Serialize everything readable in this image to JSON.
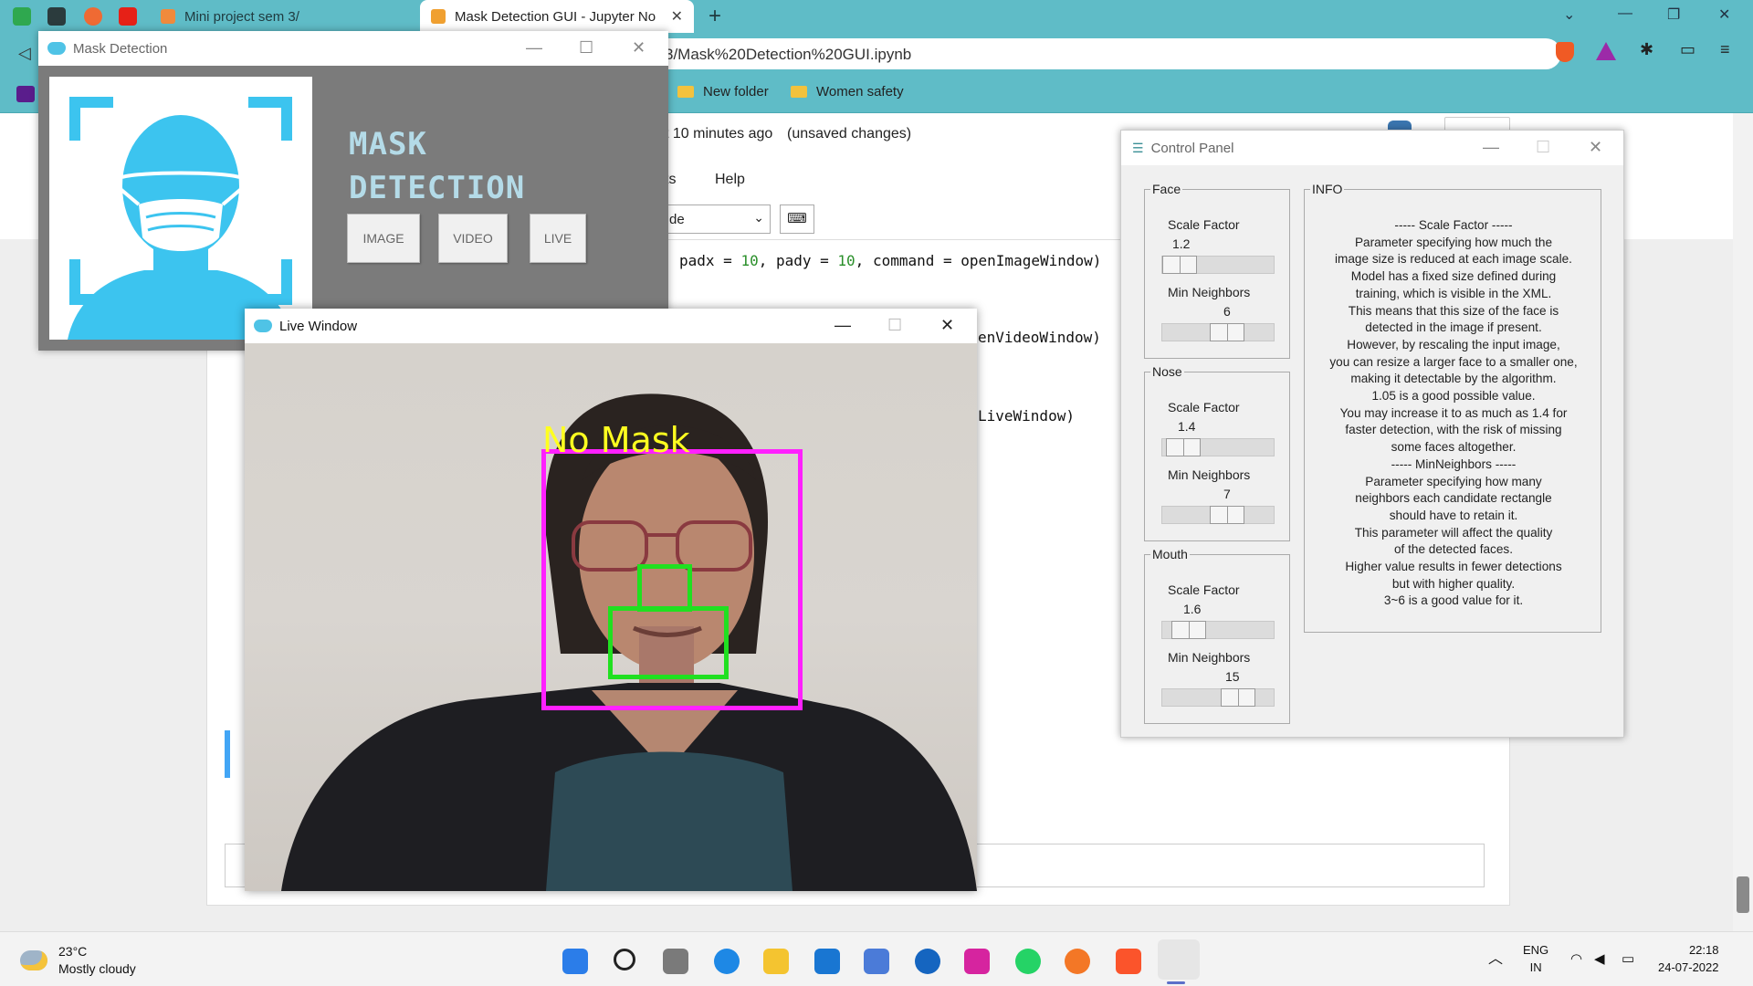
{
  "browser": {
    "tabs": [
      {
        "label": "Mini project sem 3/"
      },
      {
        "label": "Mask Detection GUI - Jupyter No"
      }
    ],
    "new_tab_symbol": "+",
    "address": "3/Mask%20Detection%20GUI.ipynb",
    "bookmarks": [
      {
        "label": "New folder"
      },
      {
        "label": "Women safety"
      }
    ]
  },
  "jupyter": {
    "save_status": "t 10 minutes ago",
    "unsaved": "(unsaved changes)",
    "menu_partial": "ts",
    "help": "Help",
    "celltype_partial": "de",
    "code_lines": [
      {
        "pre": "padx = ",
        "n1": "10",
        "mid": ", pady = ",
        "n2": "10",
        "post": ", command = openImageWindow)"
      },
      {
        "pre": "enVideoWindow)"
      },
      {
        "pre": "LiveWindow)"
      }
    ]
  },
  "main_window": {
    "title": "Mask Detection",
    "heading_line1": "MASK",
    "heading_line2": "DETECTION",
    "buttons": [
      "IMAGE",
      "VIDEO",
      "LIVE"
    ]
  },
  "live_window": {
    "title": "Live Window",
    "detection_label": "No Mask"
  },
  "control_panel": {
    "title": "Control Panel",
    "groups": [
      {
        "name": "Face",
        "scale_label": "Scale Factor",
        "scale_value": "1.2",
        "neighbors_label": "Min Neighbors",
        "neighbors_value": "6"
      },
      {
        "name": "Nose",
        "scale_label": "Scale Factor",
        "scale_value": "1.4",
        "neighbors_label": "Min Neighbors",
        "neighbors_value": "7"
      },
      {
        "name": "Mouth",
        "scale_label": "Scale Factor",
        "scale_value": "1.6",
        "neighbors_label": "Min Neighbors",
        "neighbors_value": "15"
      }
    ],
    "info_title": "INFO",
    "info_text": "----- Scale Factor -----\nParameter specifying how much the\nimage size is reduced at each image scale.\nModel has a fixed size defined during\ntraining, which is visible in the XML.\nThis means that this size of the face is\ndetected in the image if present.\nHowever, by rescaling the input image,\nyou can resize a larger face to a smaller one,\nmaking it detectable by the algorithm.\n1.05 is a good possible value.\nYou may increase it to as much as 1.4 for\nfaster detection, with the risk of missing\nsome faces altogether.\n----- MinNeighbors -----\nParameter specifying how many\nneighbors each candidate rectangle\nshould have to retain it.\nThis parameter will affect the quality\nof the detected faces.\nHigher value results in fewer detections\nbut with higher quality.\n3~6 is a good value for it."
  },
  "taskbar": {
    "temperature": "23°C",
    "weather": "Mostly cloudy",
    "lang1": "ENG",
    "lang2": "IN",
    "time": "22:18",
    "date": "24-07-2022"
  },
  "colors": {
    "browser_accent": "#5fbcc7",
    "face_box": "#ff20ff",
    "feature_box": "#20e020",
    "label_yellow": "#ffff20",
    "logo_blue": "#3cc4ef"
  }
}
